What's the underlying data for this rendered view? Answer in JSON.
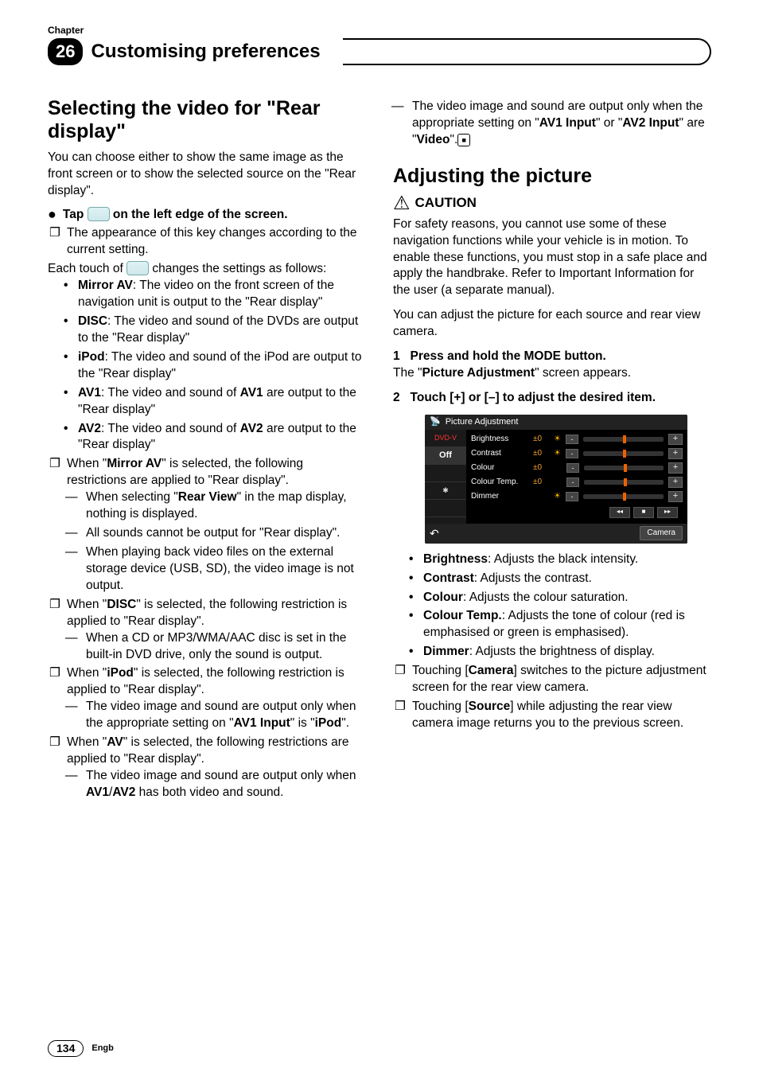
{
  "chapter_label": "Chapter",
  "chapter_number": "26",
  "chapter_title": "Customising preferences",
  "left": {
    "h2": "Selecting the video for \"Rear display\"",
    "intro": "You can choose either to show the same image as the front screen or to show the selected source on the \"Rear display\".",
    "tap_pre": "Tap ",
    "tap_post": " on the left edge of the screen.",
    "tap_note": "The appearance of this key changes according to the current setting.",
    "each_pre": "Each touch of ",
    "each_post": " changes the settings as follows:",
    "options": {
      "mirror": {
        "label": "Mirror AV",
        "desc": ": The video on the front screen of the navigation unit is output to the \"Rear display\""
      },
      "disc": {
        "label": "DISC",
        "desc": ": The video and sound of the DVDs are output to the \"Rear display\""
      },
      "ipod": {
        "label": "iPod",
        "desc": ": The video and sound of the iPod are output to the \"Rear display\""
      },
      "av1": {
        "label": "AV1",
        "desc_pre": ": The video and sound of ",
        "desc_bold": "AV1",
        "desc_post": " are output to the \"Rear display\""
      },
      "av2": {
        "label": "AV2",
        "desc_pre": ": The video and sound of ",
        "desc_bold": "AV2",
        "desc_post": " are output to the \"Rear display\""
      }
    },
    "when_mirror_pre": "When \"",
    "when_mirror_b": "Mirror AV",
    "when_mirror_post": "\" is selected, the following restrictions are applied to \"Rear display\".",
    "mirror_d1_pre": "When selecting \"",
    "mirror_d1_b": "Rear View",
    "mirror_d1_post": "\" in the map display, nothing is displayed.",
    "mirror_d2": "All sounds cannot be output for \"Rear display\".",
    "mirror_d3": "When playing back video files on the external storage device (USB, SD), the video image is not output.",
    "when_disc_pre": "When \"",
    "when_disc_b": "DISC",
    "when_disc_post": "\" is selected, the following restriction is applied to \"Rear display\".",
    "disc_d1": "When a CD or MP3/WMA/AAC disc is set in the built-in DVD drive, only the sound is output.",
    "when_ipod_pre": "When \"",
    "when_ipod_b": "iPod",
    "when_ipod_post": "\" is selected, the following restriction is applied to \"Rear display\".",
    "ipod_d1_pre": "The video image and sound are output only when the appropriate setting on \"",
    "ipod_d1_b": "AV1 Input",
    "ipod_d1_mid": "\" is \"",
    "ipod_d1_b2": "iPod",
    "ipod_d1_post": "\".",
    "when_av_pre": "When \"",
    "when_av_b": "AV",
    "when_av_post": "\" is selected, the following restrictions are applied to \"Rear display\".",
    "av_d1_pre": "The video image and sound are output only when ",
    "av_d1_b": "AV1",
    "av_d1_slash": "/",
    "av_d1_b2": "AV2",
    "av_d1_post": " has both video and sound."
  },
  "right": {
    "carry_pre": "The video image and sound are output only when the appropriate setting on \"",
    "carry_b1": "AV1 Input",
    "carry_mid": "\" or \"",
    "carry_b2": "AV2 Input",
    "carry_mid2": "\" are \"",
    "carry_b3": "Video",
    "carry_post": "\".",
    "h2": "Adjusting the picture",
    "caution": "CAUTION",
    "caution_body": "For safety reasons, you cannot use some of these navigation functions while your vehicle is in motion. To enable these functions, you must stop in a safe place and apply the handbrake. Refer to Important Information for the user (a separate manual).",
    "adjust_intro": "You can adjust the picture for each source and rear view camera.",
    "step1_num": "1",
    "step1": "Press and hold the MODE button.",
    "step1_res_pre": "The \"",
    "step1_res_b": "Picture Adjustment",
    "step1_res_post": "\" screen appears.",
    "step2_num": "2",
    "step2": "Touch [+] or [–] to adjust the desired item.",
    "shot": {
      "title": "Picture Adjustment",
      "side": [
        "DVD-V",
        "Off",
        "",
        "",
        ""
      ],
      "rows": [
        {
          "label": "Brightness",
          "val": "±0"
        },
        {
          "label": "Contrast",
          "val": "±0"
        },
        {
          "label": "Colour",
          "val": "±0"
        },
        {
          "label": "Colour Temp.",
          "val": "±0"
        },
        {
          "label": "Dimmer",
          "val": ""
        }
      ],
      "ctrl_prev": "◂◂",
      "ctrl_stop": "■",
      "ctrl_next": "▸▸",
      "camera": "Camera"
    },
    "items": {
      "brightness": {
        "b": "Brightness",
        "t": ": Adjusts the black intensity."
      },
      "contrast": {
        "b": "Contrast",
        "t": ": Adjusts the contrast."
      },
      "colour": {
        "b": "Colour",
        "t": ": Adjusts the colour saturation."
      },
      "colourtemp": {
        "b": "Colour Temp.",
        "t": ": Adjusts the tone of colour (red is emphasised or green is emphasised)."
      },
      "dimmer": {
        "b": "Dimmer",
        "t": ": Adjusts the brightness of display."
      }
    },
    "note_camera_pre": "Touching [",
    "note_camera_b": "Camera",
    "note_camera_post": "] switches to the picture adjustment screen for the rear view camera.",
    "note_source_pre": "Touching [",
    "note_source_b": "Source",
    "note_source_post": "] while adjusting the rear view camera image returns you to the previous screen."
  },
  "footer": {
    "page": "134",
    "lang": "Engb"
  }
}
